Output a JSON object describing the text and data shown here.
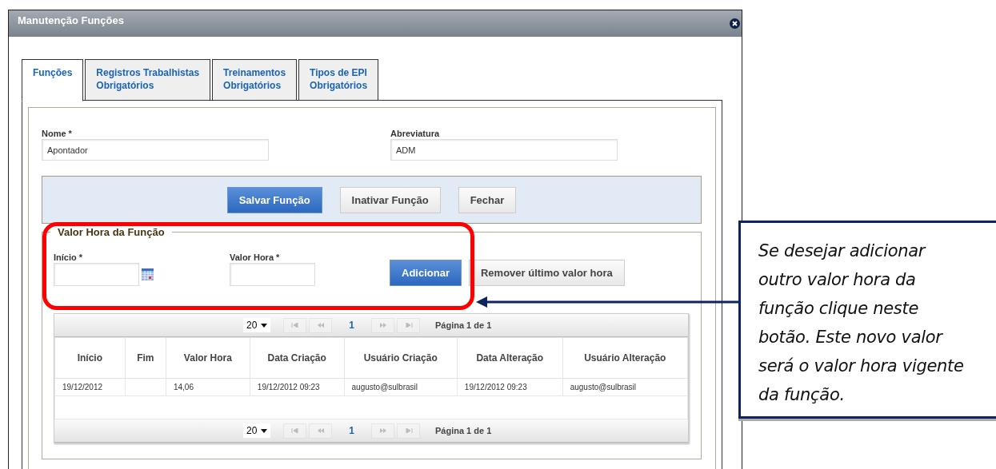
{
  "window": {
    "title": "Manutenção Funções"
  },
  "tabs": [
    {
      "lines": [
        "Funções"
      ],
      "selected": true
    },
    {
      "lines": [
        "Registros Trabalhistas",
        "Obrigatórios"
      ],
      "selected": false
    },
    {
      "lines": [
        "Treinamentos",
        "Obrigatórios"
      ],
      "selected": false
    },
    {
      "lines": [
        "Tipos de EPI",
        "Obrigatórios"
      ],
      "selected": false
    }
  ],
  "form": {
    "fields": [
      {
        "label": "Nome *",
        "value": "Apontador"
      },
      {
        "label": "Abreviatura",
        "value": "ADM"
      }
    ],
    "buttons": [
      {
        "label": "Salvar Função",
        "kind": "primary"
      },
      {
        "label": "Inativar Função",
        "kind": "secondary"
      },
      {
        "label": "Fechar",
        "kind": "secondary"
      }
    ]
  },
  "hourly_rate": {
    "legend": "Valor Hora da Função",
    "fields": [
      {
        "label": "Início *",
        "kind": "date"
      },
      {
        "label": "Valor Hora *",
        "kind": "text"
      }
    ],
    "buttons": [
      {
        "label": "Adicionar",
        "kind": "primary"
      },
      {
        "label": "Remover último valor hora",
        "kind": "secondary"
      }
    ]
  },
  "grid": {
    "top_pager": {
      "page_size": "20",
      "page": "1",
      "summary": "Página 1 de 1",
      "disabled": true
    },
    "columns": [
      "Início",
      "Fim",
      "Valor Hora",
      "Data Criação",
      "Usuário Criação",
      "Data Alteração",
      "Usuário Alteração"
    ],
    "rows": [
      [
        "19/12/2012",
        "",
        "14,06",
        "19/12/2012 09:23",
        "augusto@sulbrasil",
        "19/12/2012 09:23",
        "augusto@sulbrasil"
      ]
    ],
    "bottom_pager": {
      "page_size": "20",
      "page": "1",
      "summary": "Página 1 de 1",
      "disabled": true
    }
  },
  "callout": {
    "text": "Se desejar adicionar outro valor hora da função clique neste botão. Este novo valor será o valor hora vigente da função."
  }
}
